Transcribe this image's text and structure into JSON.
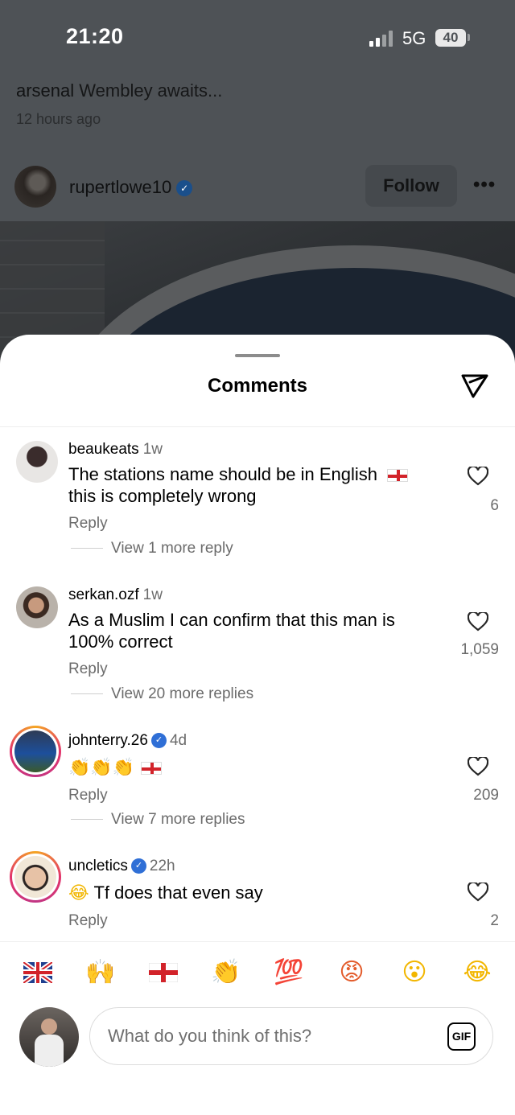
{
  "status_bar": {
    "time": "21:20",
    "network": "5G",
    "battery": "40"
  },
  "post": {
    "caption_user": "arsenal",
    "caption_text": "Wembley awaits...",
    "time_ago": "12 hours ago",
    "author": "rupertlowe10",
    "author_verified": true,
    "follow_label": "Follow",
    "more_label": "•••"
  },
  "sheet": {
    "title": "Comments"
  },
  "comments": [
    {
      "username": "beaukeats",
      "age": "1w",
      "verified": false,
      "text": "The stations name should be in English",
      "text_line2": "this is completely wrong",
      "reply_label": "Reply",
      "more_replies": "View 1 more reply",
      "likes": "6"
    },
    {
      "username": "serkan.ozf",
      "age": "1w",
      "verified": false,
      "text": "As a Muslim I can confirm that this man is",
      "text_line2": "100% correct",
      "reply_label": "Reply",
      "more_replies": "View 20 more replies",
      "likes": "1,059"
    },
    {
      "username": "johnterry.26",
      "age": "4d",
      "verified": true,
      "text": "👏👏👏",
      "reply_label": "Reply",
      "more_replies": "View 7 more replies",
      "likes": "209"
    },
    {
      "username": "uncletics",
      "age": "22h",
      "verified": true,
      "text": "Tf does that even say",
      "reply_label": "Reply",
      "likes": "2"
    }
  ],
  "reactions": [
    {
      "name": "uk-flag",
      "glyph": ""
    },
    {
      "name": "raising-hands",
      "glyph": "🙌"
    },
    {
      "name": "england-flag",
      "glyph": ""
    },
    {
      "name": "clapping-hands",
      "glyph": "👏"
    },
    {
      "name": "hundred-points",
      "glyph": "💯"
    },
    {
      "name": "angry-face",
      "glyph": "😡"
    },
    {
      "name": "surprised-face",
      "glyph": "😮"
    },
    {
      "name": "tears-of-joy",
      "glyph": "😂"
    }
  ],
  "composer": {
    "placeholder": "What do you think of this?",
    "gif_label": "GIF"
  },
  "colors": {
    "verified": "#2f6fd6",
    "flag_red": "#d2232a",
    "overlay": "#4e5256"
  }
}
